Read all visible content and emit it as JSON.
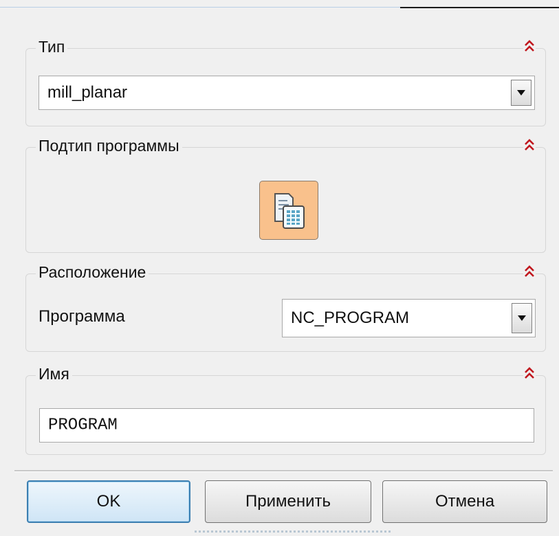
{
  "dialog": {
    "type_group": {
      "title": "Тип",
      "selected": "mill_planar"
    },
    "subtype_group": {
      "title": "Подтип программы",
      "button_icon": "program-subtype-icon"
    },
    "location_group": {
      "title": "Расположение",
      "program_label": "Программа",
      "program_value": "NC_PROGRAM"
    },
    "name_group": {
      "title": "Имя",
      "value": "PROGRAM"
    },
    "buttons": {
      "ok": "OK",
      "apply": "Применить",
      "cancel": "Отмена"
    },
    "colors": {
      "collapse_icon": "#c0161d",
      "subtype_button": "#f9c18c",
      "default_button_border": "#3c7fb1"
    }
  }
}
